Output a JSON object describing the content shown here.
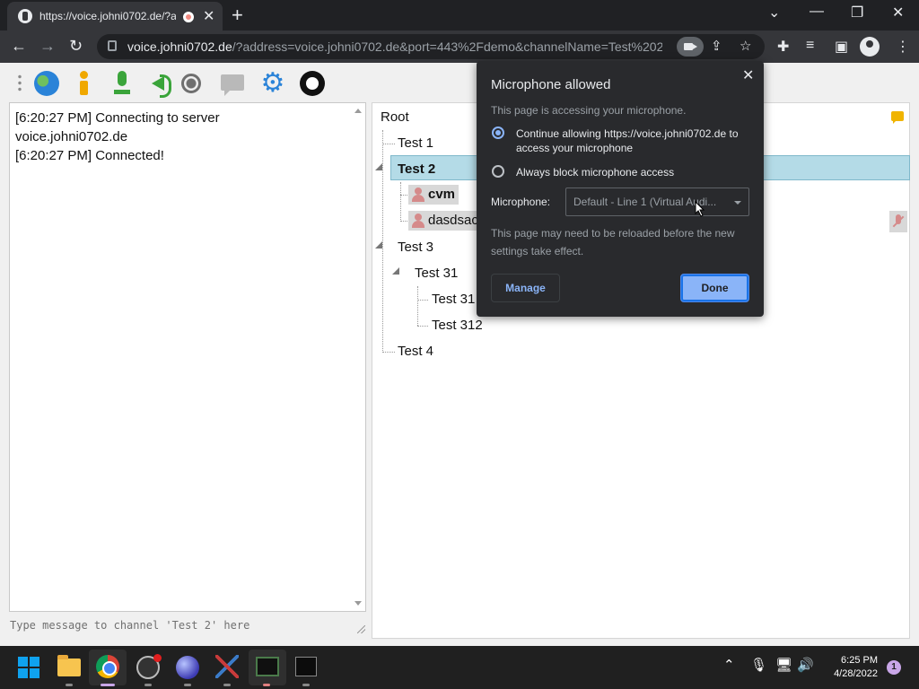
{
  "browser": {
    "tab_title": "https://voice.johni0702.de/?a",
    "url_host": "voice.johni0702.de",
    "url_rest": "/?address=voice.johni0702.de&port=443%2Fdemo&channelName=Test%202"
  },
  "log": {
    "lines": [
      "[6:20:27 PM] Connecting to server",
      "voice.johni0702.de",
      "[6:20:27 PM] Connected!"
    ],
    "input_placeholder": "Type message to channel 'Test 2' here"
  },
  "tree": {
    "root": "Root",
    "channels": {
      "test1": "Test 1",
      "test2": "Test 2",
      "test3": "Test 3",
      "test31": "Test 31",
      "test311": "Test 31",
      "test312": "Test 312",
      "test4": "Test 4"
    },
    "users": [
      "cvm",
      "dasdsac"
    ]
  },
  "popup": {
    "title": "Microphone allowed",
    "subtitle": "This page is accessing your microphone.",
    "option_allow": "Continue allowing https://voice.johni0702.de to access your microphone",
    "option_block": "Always block microphone access",
    "mic_label": "Microphone:",
    "mic_value": "Default - Line 1 (Virtual Audi...",
    "reload_note": "This page may need to be reloaded before the new settings take effect.",
    "manage": "Manage",
    "done": "Done",
    "selected_option": "allow"
  },
  "taskbar": {
    "time": "6:25 PM",
    "date": "4/28/2022",
    "notifications": "1"
  },
  "colors": {
    "selection": "#b4dbe7",
    "accent": "#8ab4f8",
    "chrome_dark": "#202124"
  }
}
